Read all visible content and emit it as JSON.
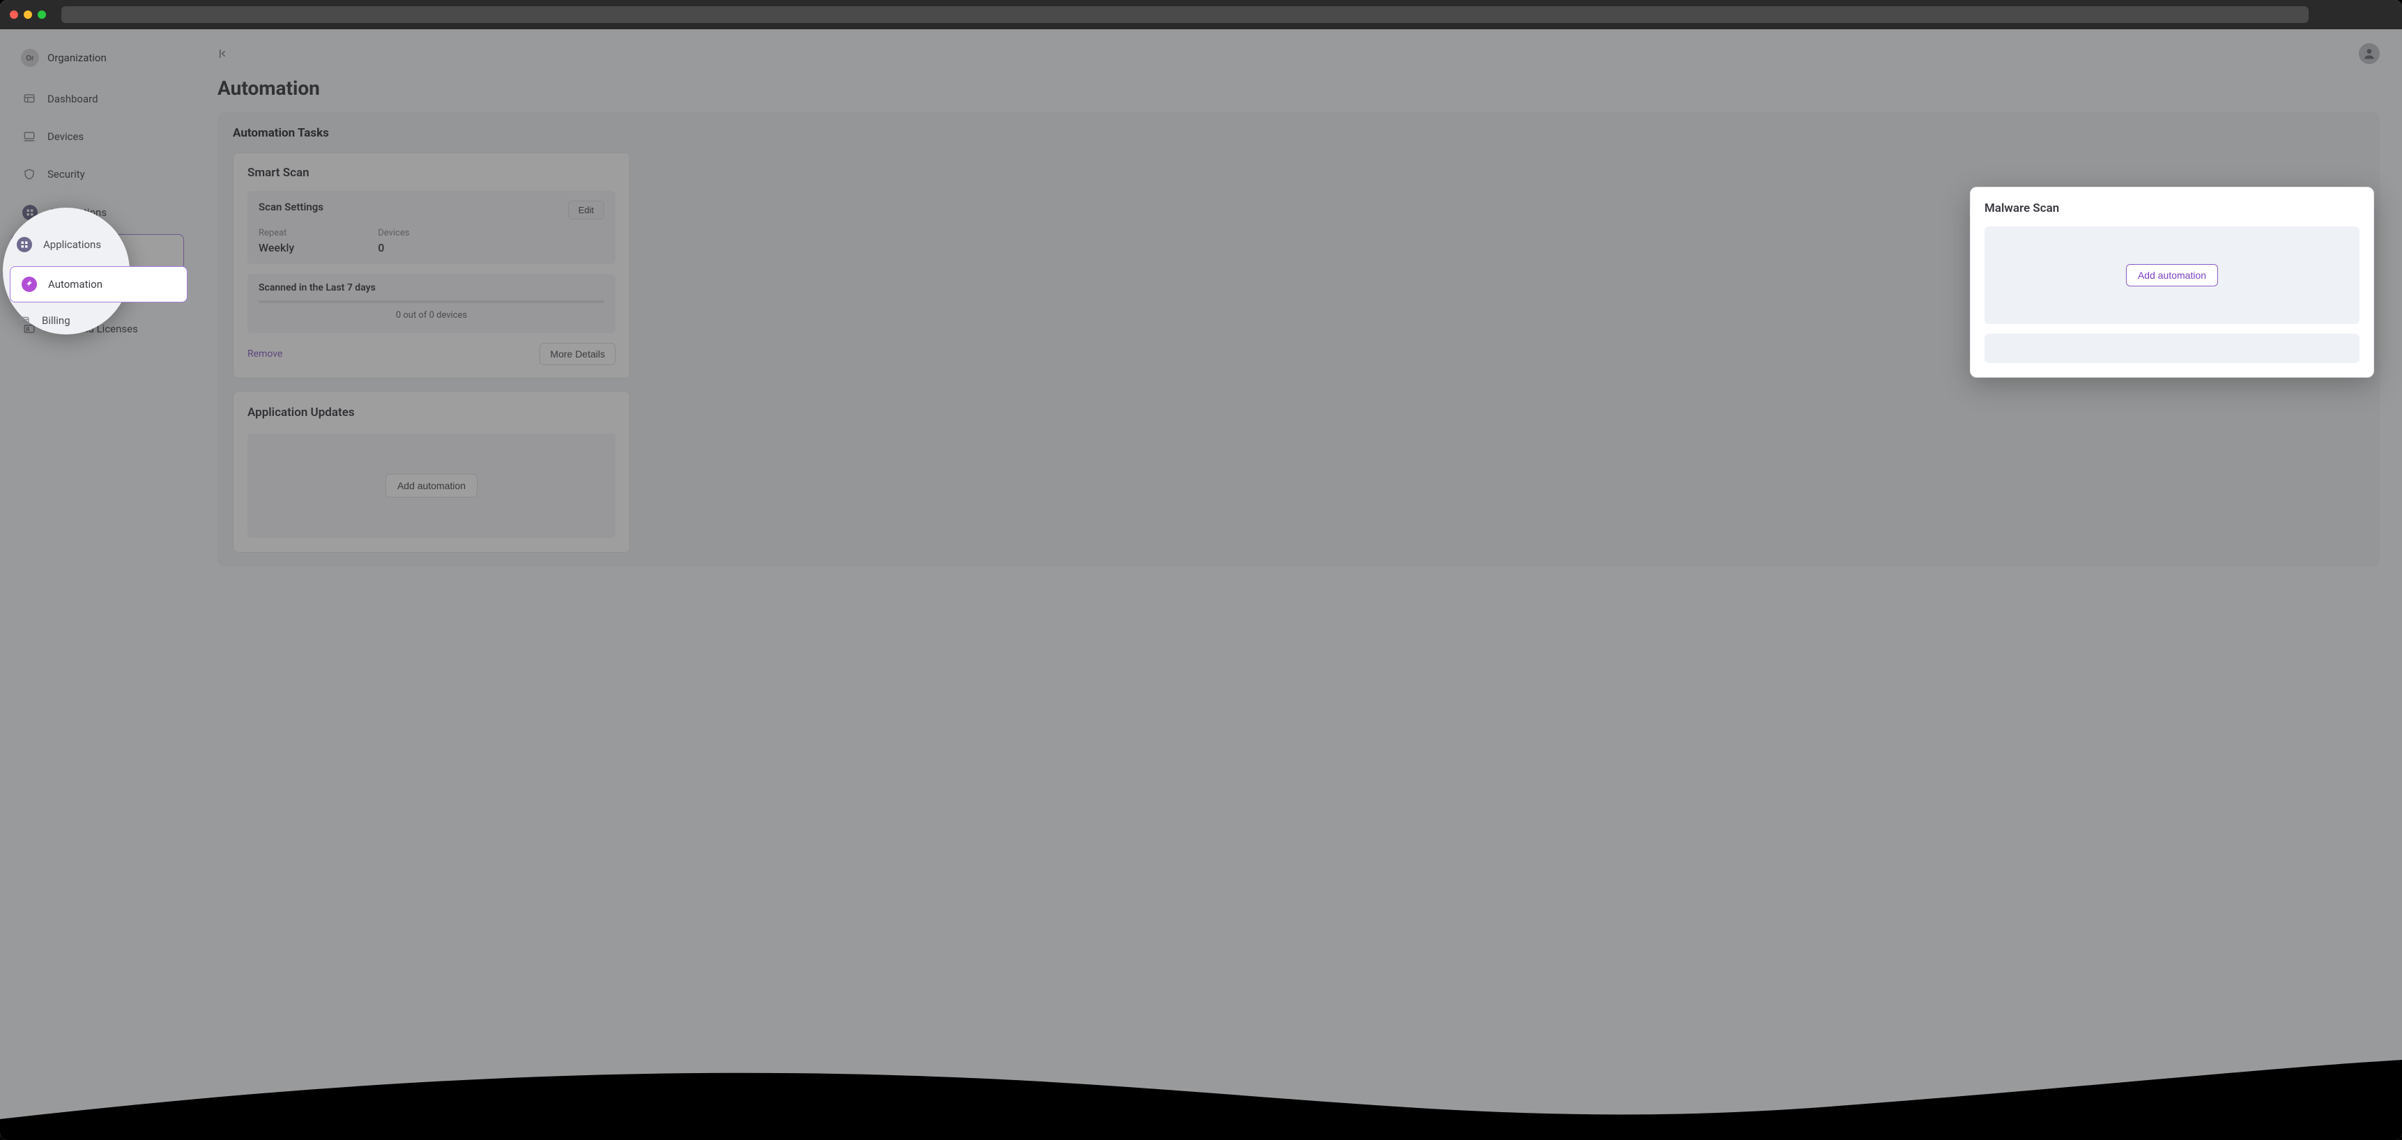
{
  "org": {
    "badge": "Or",
    "name": "Organization"
  },
  "sidebar": {
    "items": [
      {
        "label": "Dashboard",
        "icon": "dashboard"
      },
      {
        "label": "Devices",
        "icon": "monitor"
      },
      {
        "label": "Security",
        "icon": "shield"
      },
      {
        "label": "Applications",
        "icon": "apps"
      },
      {
        "label": "Automation",
        "icon": "automation",
        "active": true
      },
      {
        "label": "Billing",
        "icon": "billing"
      },
      {
        "label": "Users and Licenses",
        "icon": "users"
      }
    ]
  },
  "page": {
    "title": "Automation"
  },
  "panel": {
    "title": "Automation Tasks"
  },
  "smartScan": {
    "heading": "Smart Scan",
    "settingsLabel": "Scan Settings",
    "editLabel": "Edit",
    "repeatLabel": "Repeat",
    "repeatValue": "Weekly",
    "devicesLabel": "Devices",
    "devicesValue": "0",
    "scannedTitle": "Scanned in the Last 7 days",
    "progressText": "0 out of 0 devices",
    "removeLabel": "Remove",
    "moreLabel": "More Details"
  },
  "appUpdates": {
    "heading": "Application Updates",
    "addLabel": "Add automation"
  },
  "malware": {
    "heading": "Malware Scan",
    "addLabel": "Add automation"
  }
}
